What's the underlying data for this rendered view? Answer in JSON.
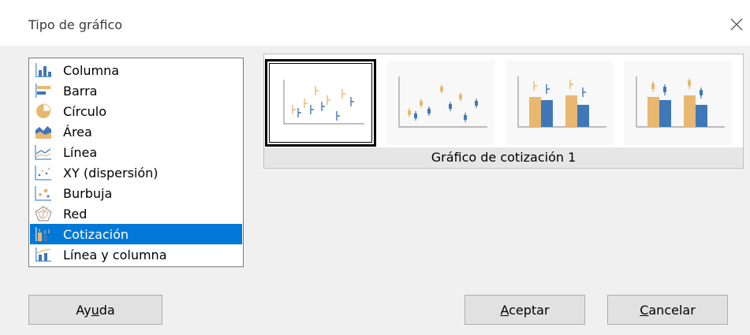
{
  "window": {
    "title": "Tipo de gráfico"
  },
  "chart_types": [
    {
      "label": "Columna",
      "icon": "column-chart-icon"
    },
    {
      "label": "Barra",
      "icon": "bar-chart-icon"
    },
    {
      "label": "Círculo",
      "icon": "pie-chart-icon"
    },
    {
      "label": "Área",
      "icon": "area-chart-icon"
    },
    {
      "label": "Línea",
      "icon": "line-chart-icon"
    },
    {
      "label": "XY (dispersión)",
      "icon": "scatter-chart-icon"
    },
    {
      "label": "Burbuja",
      "icon": "bubble-chart-icon"
    },
    {
      "label": "Red",
      "icon": "net-chart-icon"
    },
    {
      "label": "Cotización",
      "icon": "stock-chart-icon",
      "selected": true
    },
    {
      "label": "Línea y columna",
      "icon": "column-line-chart-icon"
    }
  ],
  "variants": {
    "caption": "Gráfico de cotización 1",
    "selected_index": 0,
    "items": [
      "stock-chart-variant-1-icon",
      "stock-chart-variant-2-icon",
      "stock-chart-variant-3-icon",
      "stock-chart-variant-4-icon"
    ]
  },
  "buttons": {
    "help_pre": "Ay",
    "help_mnemonic": "u",
    "help_post": "da",
    "ok_mnemonic": "A",
    "ok_rest": "ceptar",
    "cancel_mnemonic": "C",
    "cancel_rest": "ancelar"
  },
  "colors": {
    "selection": "#0078d7",
    "orange": "#e8b870",
    "blue": "#3f78b8"
  }
}
